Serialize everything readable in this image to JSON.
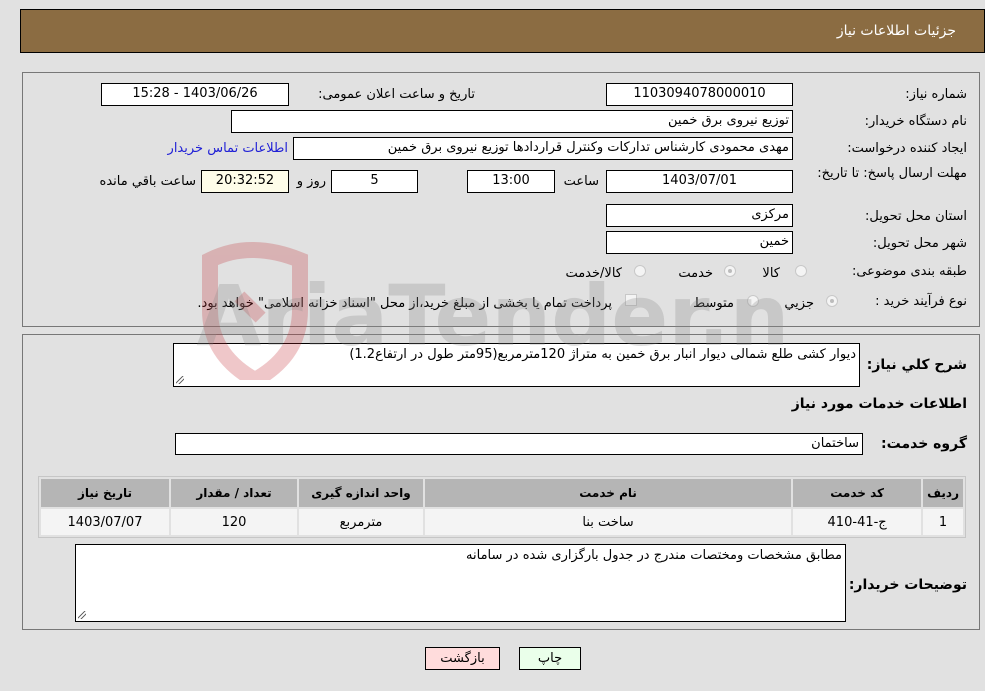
{
  "header": {
    "title": "جزئیات اطلاعات نیاز"
  },
  "form": {
    "need_number": {
      "label": "شماره نیاز:",
      "value": "1103094078000010"
    },
    "announce_datetime": {
      "label": "تاریخ و ساعت اعلان عمومی:",
      "value": "1403/06/26 - 15:28"
    },
    "buyer_org": {
      "label": "نام دستگاه خریدار:",
      "value": "توزیع نیروی برق خمین"
    },
    "requester": {
      "label": "ایجاد کننده درخواست:",
      "value": "مهدی محمودی کارشناس تدارکات وکنترل قراردادها توزیع نیروی برق خمین"
    },
    "buyer_contact_link": "اطلاعات تماس خریدار",
    "deadline": {
      "label": "مهلت ارسال پاسخ: تا تاریخ:",
      "date": "1403/07/01",
      "time_label": "ساعت",
      "time": "13:00",
      "days": "5",
      "days_label": "روز و",
      "remaining": "20:32:52",
      "remaining_label": "ساعت باقي مانده"
    },
    "province": {
      "label": "استان محل تحویل:",
      "value": "مرکزی"
    },
    "city": {
      "label": "شهر محل تحویل:",
      "value": "خمین"
    },
    "category": {
      "label": "طبقه بندی موضوعی:",
      "options": [
        {
          "label": "کالا",
          "checked": false
        },
        {
          "label": "خدمت",
          "checked": true
        },
        {
          "label": "کالا/خدمت",
          "checked": false
        }
      ]
    },
    "purchase_type": {
      "label": "نوع فرآیند خرید :",
      "options": [
        {
          "label": "جزيي",
          "checked": true
        },
        {
          "label": "متوسط",
          "checked": false
        }
      ],
      "treasury_note": "پرداخت تمام یا بخشی از مبلغ خرید،از محل \"اسناد خزانه اسلامی\" خواهد بود."
    }
  },
  "details": {
    "summary_label": "شرح کلي نياز:",
    "summary_value": "دیوار کشی طلع شمالی دیوار انبار برق خمین به متراژ 120مترمربع(95متر طول در ارتفاع1.2)",
    "services_title": "اطلاعات خدمات مورد نیاز",
    "service_group_label": "گروه خدمت:",
    "service_group_value": "ساختمان",
    "table": {
      "headers": [
        "ردیف",
        "کد خدمت",
        "نام خدمت",
        "واحد اندازه گیری",
        "تعداد / مقدار",
        "تاریخ نیاز"
      ],
      "rows": [
        [
          "1",
          "ج-41-410",
          "ساخت بنا",
          "مترمربع",
          "120",
          "1403/07/07"
        ]
      ]
    },
    "buyer_notes_label": "توضیحات خریدار:",
    "buyer_notes_value": "مطابق مشخصات ومختصات مندرج در جدول بارگزاری شده در سامانه"
  },
  "buttons": {
    "print": "چاپ",
    "back": "بازگشت"
  },
  "watermark": "AriaTender.neT",
  "colors": {
    "header_bg": "#8b6c42",
    "link": "#2121d6",
    "print_bg": "#eaffea",
    "back_bg": "#ffdcdc",
    "remaining_bg": "#fefde9"
  }
}
